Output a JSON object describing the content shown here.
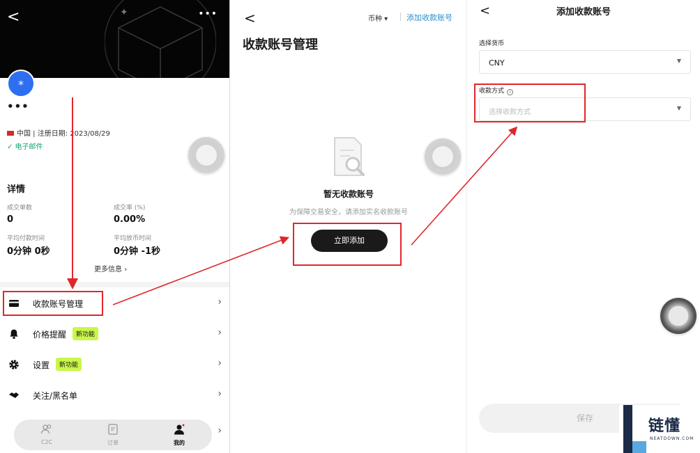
{
  "panel1": {
    "back_glyph": "<",
    "more_glyph": "•••",
    "avatar_glyph": "*",
    "username": "•••",
    "region_registration": "中国 | 注册日期: 2023/08/29",
    "email_verified": "✓ 电子邮件",
    "details_heading": "详情",
    "stats": [
      {
        "label": "成交单数",
        "value": "0"
      },
      {
        "label": "成交率 (%)",
        "value": "0.00%"
      },
      {
        "label": "平均付款时间",
        "value": "0分钟 0秒"
      },
      {
        "label": "平均放币时间",
        "value": "0分钟 -1秒"
      }
    ],
    "more_info": "更多信息 ›",
    "menu": [
      {
        "label": "收款账号管理",
        "icon": "card-icon",
        "badge": ""
      },
      {
        "label": "价格提醒",
        "icon": "bell-icon",
        "badge": "新功能"
      },
      {
        "label": "设置",
        "icon": "gear-icon",
        "badge": "新功能"
      },
      {
        "label": "关注/黑名单",
        "icon": "handshake-icon",
        "badge": ""
      }
    ],
    "chevron": "›",
    "bottom_nav": [
      {
        "label": "C2C",
        "icon": "users-icon"
      },
      {
        "label": "订单",
        "icon": "orders-icon"
      },
      {
        "label": "我的",
        "icon": "profile-icon"
      }
    ]
  },
  "panel2": {
    "back_glyph": "<",
    "currency_filter": "币种 ▾",
    "add_account_link": "添加收款账号",
    "title": "收款账号管理",
    "empty_title": "暂无收款账号",
    "empty_subtitle": "为保障交易安全，请添加实名收款账号",
    "add_now_button": "立即添加"
  },
  "panel3": {
    "back_glyph": "<",
    "title": "添加收款账号",
    "currency_label": "选择货币",
    "currency_value": "CNY",
    "method_label": "收款方式",
    "method_info": "i",
    "method_placeholder": "选择收款方式",
    "caret": "▼",
    "save_button": "保存"
  },
  "watermark": {
    "letter": "L",
    "name": "链懂",
    "site": "NEATDOWN.COM"
  },
  "colors": {
    "accent_link": "#2c8fc7",
    "badge_new": "#c9f74a",
    "annotation_red": "#e0262a",
    "verified_green": "#1aa37a",
    "avatar_blue": "#2d6ff0"
  }
}
